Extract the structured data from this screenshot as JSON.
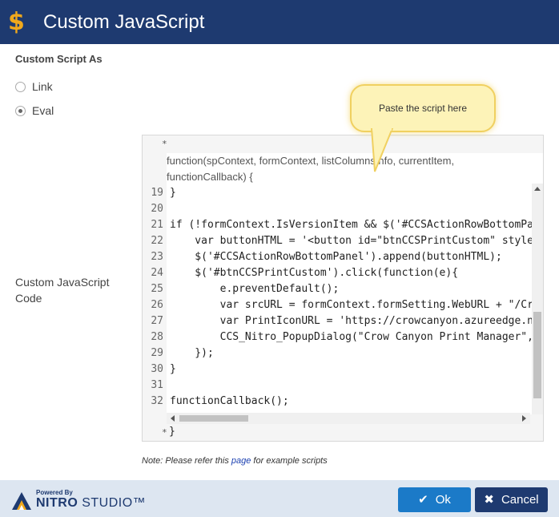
{
  "header": {
    "icon": "dollar-icon",
    "title": "Custom JavaScript",
    "colors": {
      "background": "#1e3a70",
      "icon": "#f0a81c"
    }
  },
  "form": {
    "section_label": "Custom Script As",
    "radios": [
      {
        "label": "Link",
        "checked": false
      },
      {
        "label": "Eval",
        "checked": true
      }
    ],
    "code_label": "Custom JavaScript Code"
  },
  "editor": {
    "fold_top": "*",
    "fold_bottom": "*",
    "fold_bottom_text": "}",
    "widget_lines": [
      "function(spContext, formContext, listColumnsInfo, currentItem,",
      "functionCallback) {"
    ],
    "lines": [
      {
        "n": "19",
        "text": "}"
      },
      {
        "n": "20",
        "text": ""
      },
      {
        "n": "21",
        "text": "if (!formContext.IsVersionItem && $('#CCSActionRowBottomPan"
      },
      {
        "n": "22",
        "text": "    var buttonHTML = '<button id=\"btnCCSPrintCustom\" style="
      },
      {
        "n": "23",
        "text": "    $('#CCSActionRowBottomPanel').append(buttonHTML);"
      },
      {
        "n": "24",
        "text": "    $('#btnCCSPrintCustom').click(function(e){"
      },
      {
        "n": "25",
        "text": "        e.preventDefault();"
      },
      {
        "n": "26",
        "text": "        var srcURL = formContext.formSetting.WebURL + \"/Cro"
      },
      {
        "n": "27",
        "text": "        var PrintIconURL = 'https://crowcanyon.azureedge.ne"
      },
      {
        "n": "28",
        "text": "        CCS_Nitro_PopupDialog(\"Crow Canyon Print Manager\","
      },
      {
        "n": "29",
        "text": "    });"
      },
      {
        "n": "30",
        "text": "}"
      },
      {
        "n": "31",
        "text": ""
      },
      {
        "n": "32",
        "text": "functionCallback();"
      }
    ]
  },
  "callout": {
    "text": "Paste the script here"
  },
  "note": {
    "prefix": "Note: Please refer this ",
    "link": "page",
    "suffix": " for example scripts"
  },
  "footer": {
    "logo": {
      "icon": "nitro-logo-icon",
      "powered_by": "Powered By",
      "brand_bold": "NITRO",
      "brand_light": " STUDIO™"
    },
    "ok_label": "Ok",
    "ok_icon": "check-icon",
    "cancel_label": "Cancel",
    "cancel_icon": "close-icon",
    "colors": {
      "ok": "#1b7ac8",
      "cancel": "#1e3a70",
      "background": "#dde6f1"
    }
  }
}
